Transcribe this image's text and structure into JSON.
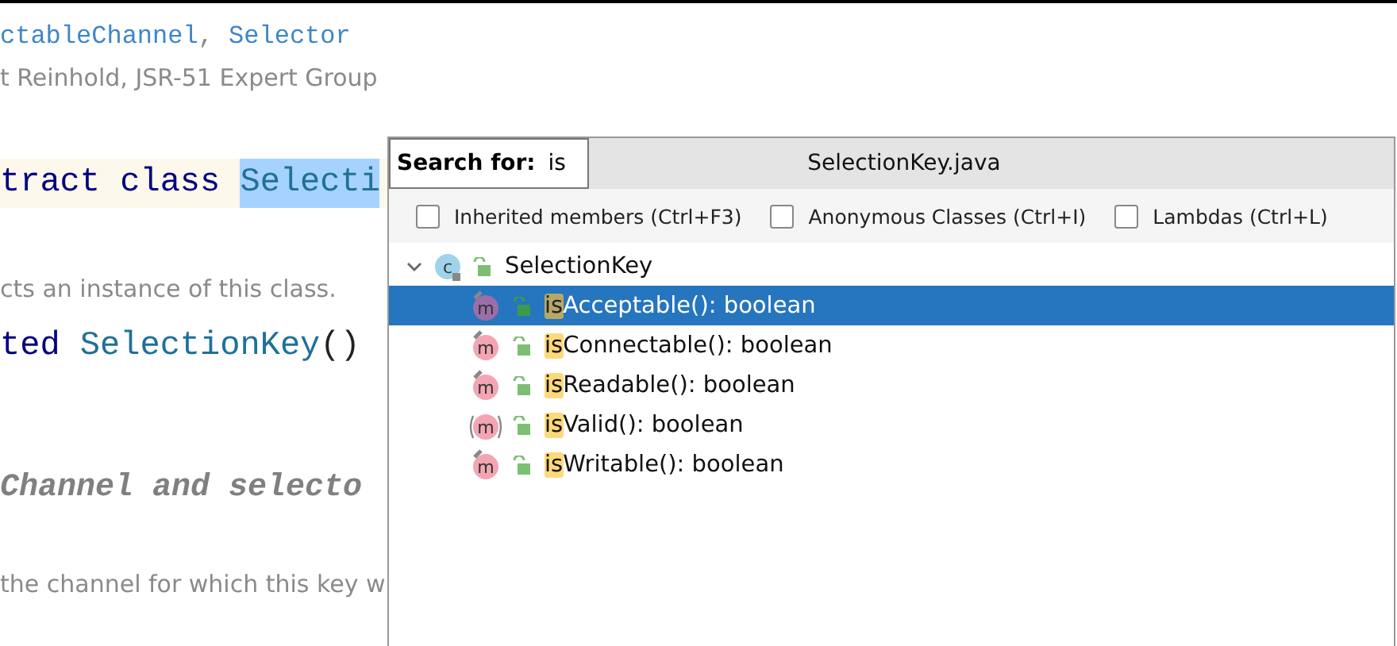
{
  "editor": {
    "lines": [
      {
        "kind": "see",
        "parts": [
          {
            "text": "ctableChannel",
            "link": true
          },
          {
            "text": ", ",
            "link": false
          },
          {
            "text": "Selector",
            "link": true
          }
        ]
      },
      {
        "kind": "doc",
        "text": "t Reinhold, JSR-51 Expert Group"
      },
      {
        "kind": "code",
        "parts": [
          {
            "text": "tract class ",
            "kind": "keyword",
            "selected": false
          },
          {
            "text": "Selecti",
            "kind": "ident",
            "selected": true
          }
        ]
      },
      {
        "kind": "doc",
        "text": "cts an instance of this class."
      },
      {
        "kind": "code",
        "parts": [
          {
            "text": "ted ",
            "kind": "keyword",
            "selected": false
          },
          {
            "text": "SelectionKey",
            "kind": "ident",
            "selected": false
          },
          {
            "text": "()",
            "kind": "plain",
            "selected": false
          }
        ]
      },
      {
        "kind": "heading",
        "text": "Channel and selecto"
      },
      {
        "kind": "doc",
        "text": "the channel for which this key w"
      }
    ]
  },
  "popup": {
    "search": {
      "label": "Search for:",
      "value": "is"
    },
    "title": "SelectionKey.java",
    "filters": [
      {
        "label": "Inherited members (Ctrl+F3)",
        "checked": false
      },
      {
        "label": "Anonymous Classes (Ctrl+I)",
        "checked": false
      },
      {
        "label": "Lambdas (Ctrl+L)",
        "checked": false
      }
    ],
    "tree": {
      "icon": "c",
      "label": "SelectionKey",
      "expanded": true,
      "children": [
        {
          "icon": "m",
          "match": "is",
          "label": "Acceptable(): boolean",
          "selected": true,
          "abstract": false
        },
        {
          "icon": "m",
          "match": "is",
          "label": "Connectable(): boolean",
          "selected": false,
          "abstract": false
        },
        {
          "icon": "m",
          "match": "is",
          "label": "Readable(): boolean",
          "selected": false,
          "abstract": false
        },
        {
          "icon": "m",
          "match": "is",
          "label": "Valid(): boolean",
          "selected": false,
          "abstract": true
        },
        {
          "icon": "m",
          "match": "is",
          "label": "Writable(): boolean",
          "selected": false,
          "abstract": false
        }
      ]
    }
  }
}
